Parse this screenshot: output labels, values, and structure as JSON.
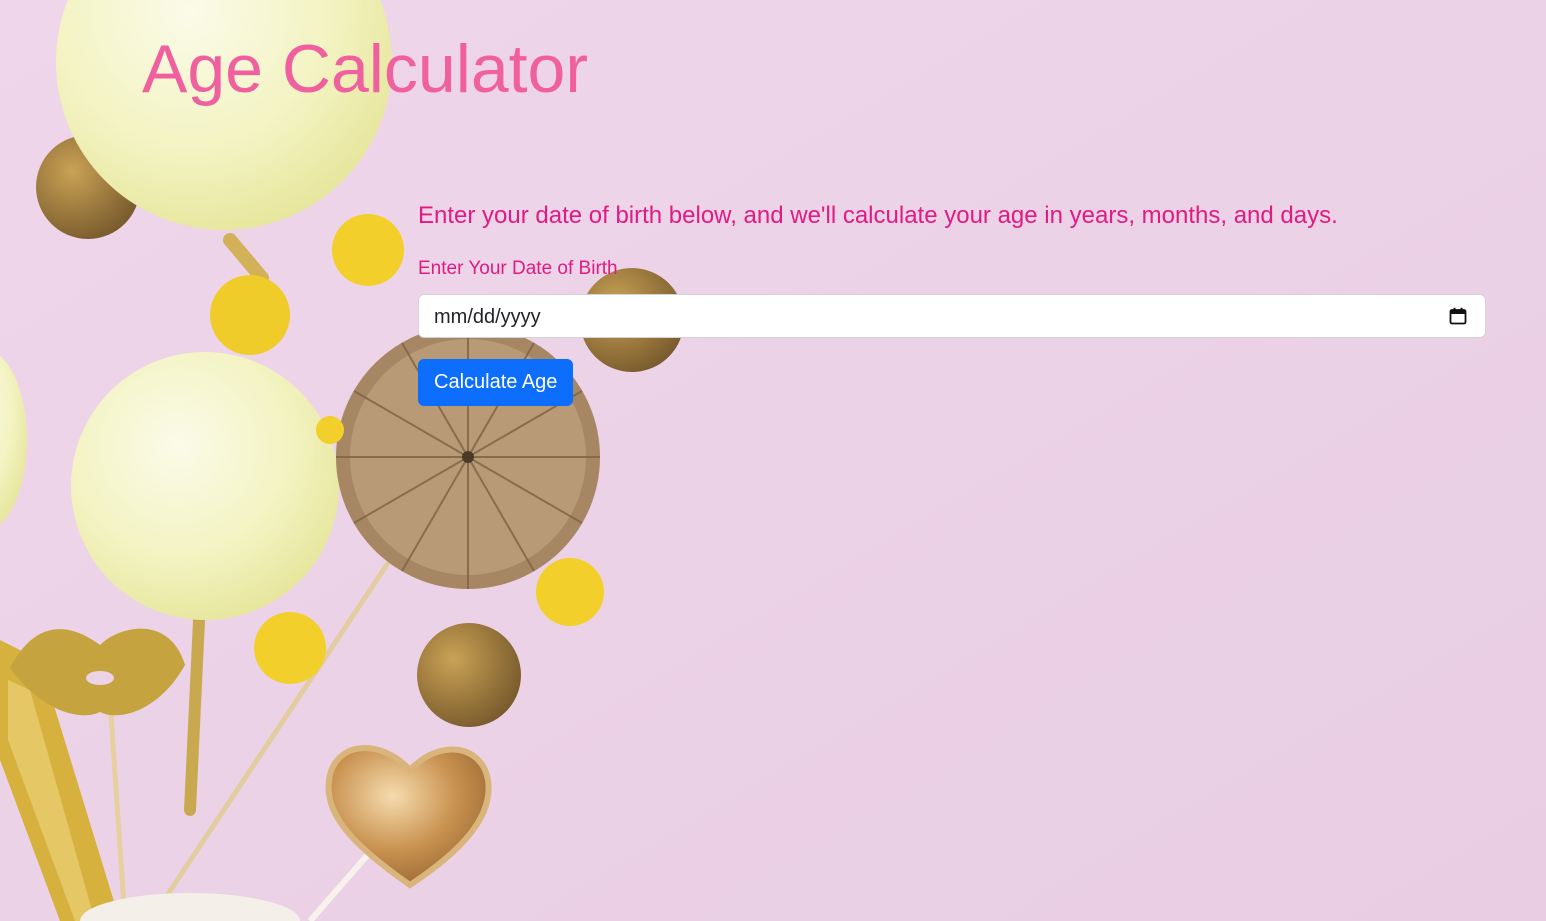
{
  "page": {
    "title": "Age Calculator"
  },
  "main": {
    "intro": "Enter your date of birth below, and we'll calculate your age in years, months, and days.",
    "dob_label": "Enter Your Date of Birth",
    "dob_placeholder": "mm/dd/yyyy",
    "calculate_label": "Calculate Age"
  },
  "icons": {
    "date_picker": "calendar-icon"
  },
  "colors": {
    "background": "#ecd3e7",
    "title": "#f0609f",
    "text": "#e01b84",
    "button": "#0d6efd",
    "button_text": "#ffffff"
  }
}
